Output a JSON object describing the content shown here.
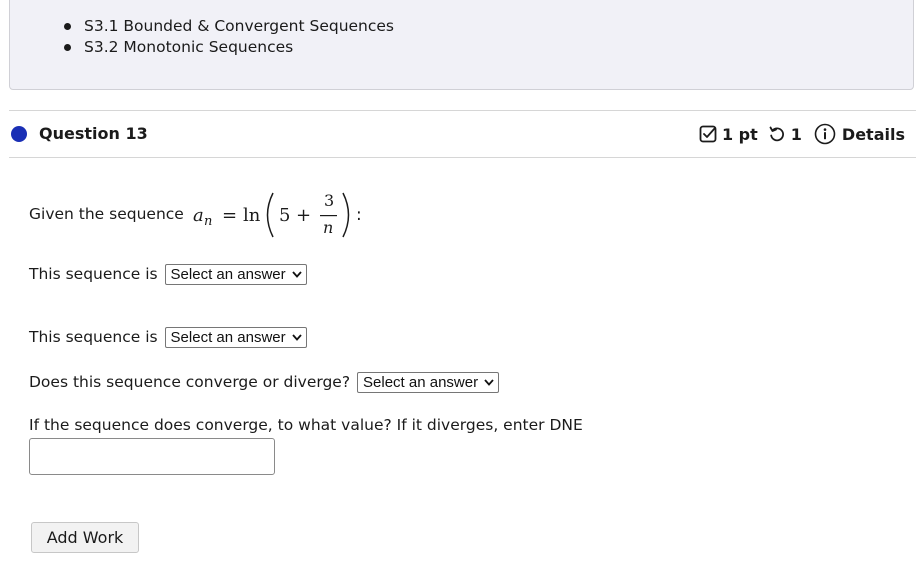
{
  "resources": {
    "items": [
      "S3.1 Bounded & Convergent Sequences",
      "S3.2 Monotonic Sequences"
    ]
  },
  "question": {
    "title": "Question 13",
    "points": "1 pt",
    "attempts": "1",
    "details": "Details",
    "status_color": "#1a2fb5"
  },
  "body": {
    "stem_prefix": "Given the sequence",
    "formula": {
      "a": "a",
      "sub": "n",
      "equals": "=",
      "fn": "ln",
      "five": "5",
      "plus": "+",
      "num": "3",
      "den": "n",
      "colon": ":"
    },
    "q1_label": "This sequence is",
    "q2_label": "This sequence is",
    "q3_label": "Does this sequence converge or diverge?",
    "q4_label": "If the sequence does converge, to what value? If it diverges, enter DNE",
    "select_placeholder": "Select an answer",
    "input_value": "",
    "add_work_label": "Add Work"
  }
}
